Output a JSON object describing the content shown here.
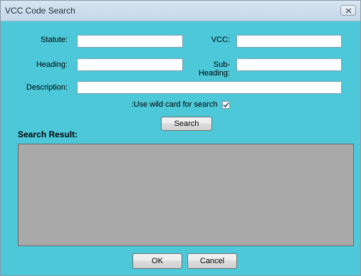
{
  "window": {
    "title": "VCC Code Search"
  },
  "form": {
    "statute_label": "Statute:",
    "statute_value": "",
    "vcc_label": "VCC:",
    "vcc_value": "",
    "heading_label": "Heading:",
    "heading_value": "",
    "subheading_label": "Sub-Heading:",
    "subheading_value": "",
    "description_label": "Description:",
    "description_value": "",
    "wildcard_label": ":Use wild card for search",
    "wildcard_checked": true,
    "search_label": "Search"
  },
  "results": {
    "title": "Search Result:",
    "items": []
  },
  "footer": {
    "ok_label": "OK",
    "cancel_label": "Cancel"
  },
  "icons": {
    "close": "close-icon",
    "check": "checkmark-icon"
  },
  "colors": {
    "client_background": "#4cc8d8",
    "results_background": "#a9a9a9",
    "titlebar": "#c4d6e8"
  }
}
